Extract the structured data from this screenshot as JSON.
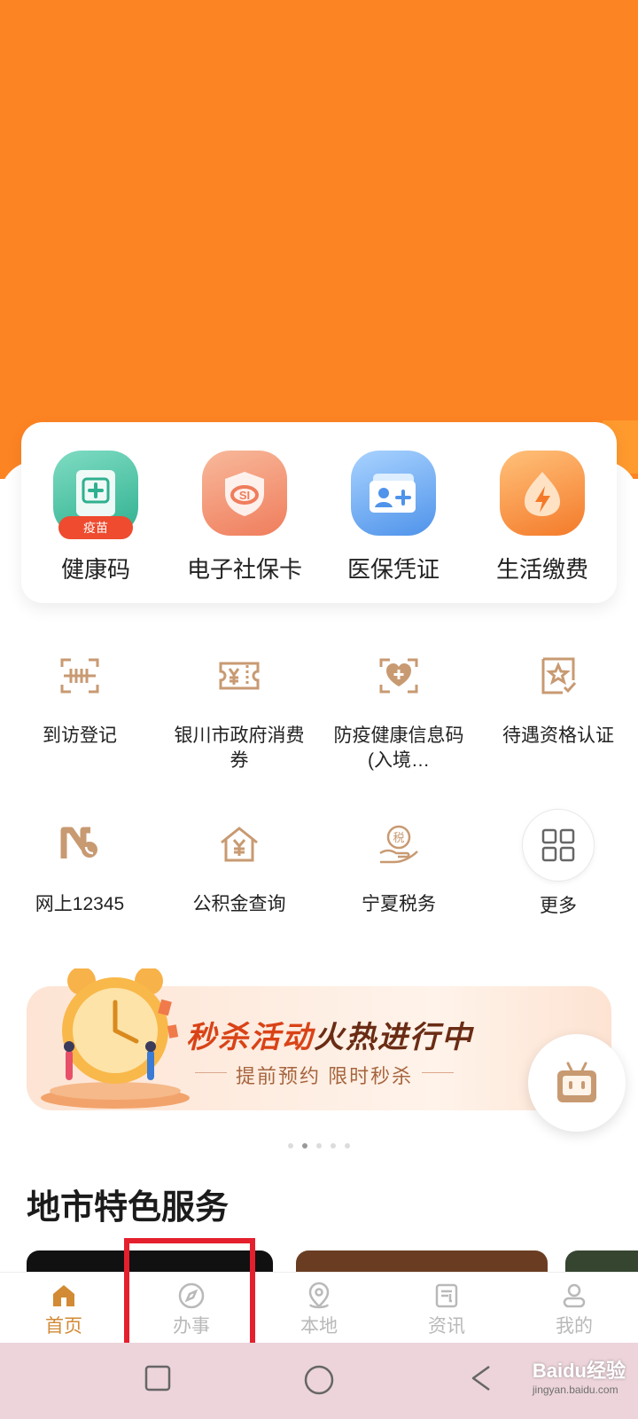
{
  "colors": {
    "header_orange": "#fd8423",
    "tab_active": "#d28a35",
    "tab_inactive": "#b9b9b9",
    "icon_tan": "#c89a72",
    "highlight_red": "#e5202e"
  },
  "main_services": [
    {
      "label": "健康码",
      "icon": "health-code-icon",
      "badge": "疫苗"
    },
    {
      "label": "电子社保卡",
      "icon": "social-security-card-icon"
    },
    {
      "label": "医保凭证",
      "icon": "medical-insurance-icon"
    },
    {
      "label": "生活缴费",
      "icon": "utility-payment-icon"
    }
  ],
  "grid_services": [
    {
      "label": "到访登记",
      "icon": "visitor-registration-icon"
    },
    {
      "label": "银川市政府消费券",
      "icon": "voucher-icon"
    },
    {
      "label": "防疫健康信息码(入境…",
      "icon": "epidemic-health-icon"
    },
    {
      "label": "待遇资格认证",
      "icon": "qualification-certification-icon"
    },
    {
      "label": "网上12345",
      "icon": "hotline-12345-icon"
    },
    {
      "label": "公积金查询",
      "icon": "housing-fund-icon"
    },
    {
      "label": "宁夏税务",
      "icon": "tax-icon"
    },
    {
      "label": "更多",
      "icon": "more-grid-icon"
    }
  ],
  "banner": {
    "title_part1": "秒杀活动",
    "title_part2": "火热进行中",
    "subtitle": "提前预约  限时秒杀",
    "carousel_count": 5,
    "carousel_active": 2
  },
  "section": {
    "title": "地市特色服务"
  },
  "tabbar": [
    {
      "label": "首页",
      "icon": "home-icon",
      "active": true
    },
    {
      "label": "办事",
      "icon": "compass-icon",
      "active": false
    },
    {
      "label": "本地",
      "icon": "location-pin-icon",
      "active": false
    },
    {
      "label": "资讯",
      "icon": "news-icon",
      "active": false
    },
    {
      "label": "我的",
      "icon": "profile-icon",
      "active": false
    }
  ],
  "watermark": {
    "brand": "Baidu经验",
    "url": "jingyan.baidu.com"
  }
}
